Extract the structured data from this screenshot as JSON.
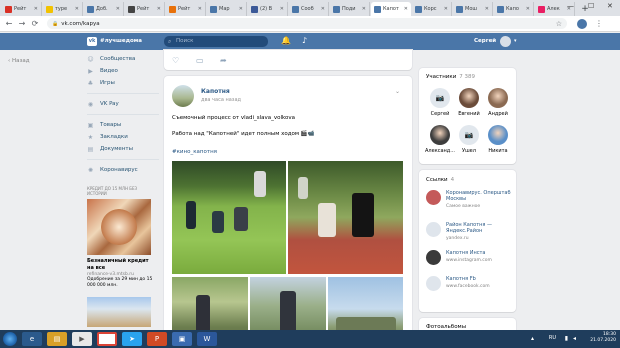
{
  "browser": {
    "tabs": [
      {
        "label": "Рейт",
        "color": "#d93025"
      },
      {
        "label": "туре",
        "color": "#f2c200"
      },
      {
        "label": "Доб.",
        "color": "#4a76a8"
      },
      {
        "label": "Рейт",
        "color": "#444444"
      },
      {
        "label": "Рейт",
        "color": "#e8710a"
      },
      {
        "label": "Мар",
        "color": "#4a76a8"
      },
      {
        "label": "(2) В",
        "color": "#3b5998"
      },
      {
        "label": "Сооб",
        "color": "#4a76a8"
      },
      {
        "label": "Поди",
        "color": "#4a76a8"
      },
      {
        "label": "Капот",
        "color": "#4a76a8",
        "active": true
      },
      {
        "label": "Корс",
        "color": "#4a76a8"
      },
      {
        "label": "Мош",
        "color": "#4a76a8"
      },
      {
        "label": "Капо",
        "color": "#4a76a8"
      },
      {
        "label": "Алек",
        "color": "#e91e63"
      }
    ],
    "url": "vk.com/kapya"
  },
  "vk_header": {
    "slogan": "#лучшедома",
    "search_placeholder": "Поиск",
    "user_name": "Сергей"
  },
  "back_nav": "Назад",
  "left_menu": [
    {
      "icon": "people-icon",
      "label": "Сообщества"
    },
    {
      "icon": "video-icon",
      "label": "Видео"
    },
    {
      "icon": "games-icon",
      "label": "Игры"
    },
    {
      "sep": true
    },
    {
      "icon": "vkpay-icon",
      "label": "VK Pay"
    },
    {
      "sep": true
    },
    {
      "icon": "bag-icon",
      "label": "Товары"
    },
    {
      "icon": "bookmark-icon",
      "label": "Закладки"
    },
    {
      "icon": "doc-icon",
      "label": "Документы"
    },
    {
      "sep": true
    },
    {
      "icon": "virus-icon",
      "label": "Коронавирус"
    }
  ],
  "ad": {
    "top": "КРЕДИТ ДО 15 МЛН БЕЗ ИСТОРИИ",
    "title": "Безналичный кредит на все",
    "site": "refinance-v3.mtsb.ru",
    "text": "Одобрение за 29 мин до 15 000 000 млн."
  },
  "post": {
    "author": "Капотня",
    "date": "два часа назад",
    "line1": "Съемочный процесс от vladi_slava_volkova",
    "line2": "Работа над \"Капотней\" идет полным ходом 🎬📹",
    "hashtag": "#кино_капотня"
  },
  "members": {
    "title": "Участники",
    "count": "7 389",
    "people": [
      {
        "name": "Сергей",
        "photo": false
      },
      {
        "name": "Евгений",
        "photo": true,
        "color": "#6b4c3a"
      },
      {
        "name": "Андрей",
        "photo": true,
        "color": "#8b6a52"
      },
      {
        "name": "Александ...",
        "photo": true,
        "color": "#3d3d3d"
      },
      {
        "name": "Ушел",
        "photo": false
      },
      {
        "name": "Никита",
        "photo": true,
        "color": "#5a8fc8"
      }
    ]
  },
  "links": {
    "title": "Ссылки",
    "count": "4",
    "items": [
      {
        "title": "Коронавирус. Оперштаб Москвы",
        "sub": "Самое важное",
        "color": "#c45a5a"
      },
      {
        "title": "Район Капотня — Яндекс.Район",
        "sub": "yandex.ru",
        "color": "#dfe5ec"
      },
      {
        "title": "Капотня Инста",
        "sub": "www.instagram.com",
        "color": "#3a3a3a"
      },
      {
        "title": "Капотня Fb",
        "sub": "www.facebook.com",
        "color": "#dfe5ec"
      }
    ]
  },
  "photo_albums": "Фотоальбомы",
  "taskbar": {
    "lang": "RU",
    "time": "18:30",
    "date": "21.07.2020"
  }
}
